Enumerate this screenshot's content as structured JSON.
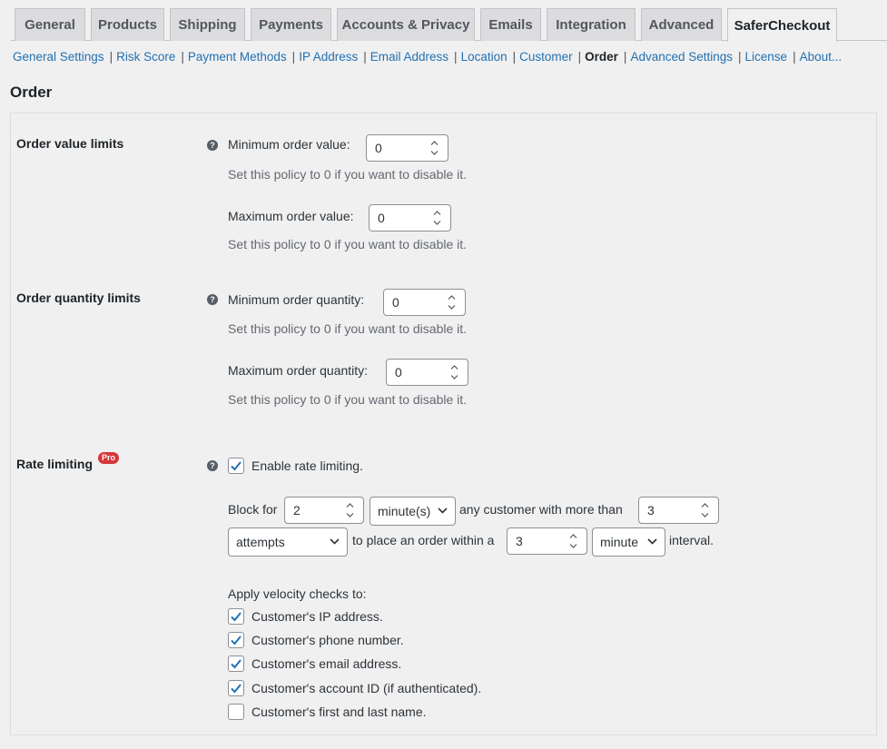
{
  "tabs": [
    {
      "label": "General"
    },
    {
      "label": "Products"
    },
    {
      "label": "Shipping"
    },
    {
      "label": "Payments"
    },
    {
      "label": "Accounts & Privacy"
    },
    {
      "label": "Emails"
    },
    {
      "label": "Integration"
    },
    {
      "label": "Advanced"
    },
    {
      "label": "SaferCheckout",
      "active": true
    }
  ],
  "subnav": [
    {
      "label": "General Settings"
    },
    {
      "label": "Risk Score"
    },
    {
      "label": "Payment Methods"
    },
    {
      "label": "IP Address"
    },
    {
      "label": "Email Address"
    },
    {
      "label": "Location"
    },
    {
      "label": "Customer"
    },
    {
      "label": "Order",
      "current": true
    },
    {
      "label": "Advanced Settings"
    },
    {
      "label": "License"
    },
    {
      "label": "About..."
    }
  ],
  "page_title": "Order",
  "disable_hint": "Set this policy to 0 if you want to disable it.",
  "order_value": {
    "label": "Order value limits",
    "min_label": "Minimum order value:",
    "min_value": "0",
    "max_label": "Maximum order value:",
    "max_value": "0"
  },
  "order_quantity": {
    "label": "Order quantity limits",
    "min_label": "Minimum order quantity:",
    "min_value": "0",
    "max_label": "Maximum order quantity:",
    "max_value": "0"
  },
  "rate_limiting": {
    "label": "Rate limiting",
    "badge": "Pro",
    "enable_label": "Enable rate limiting.",
    "enabled": true,
    "block_for_text": "Block for",
    "block_value": "2",
    "block_unit": "minute(s)",
    "any_customer_text": "any customer with more than",
    "attempts_value": "3",
    "attempts_select": "attempts",
    "place_order_text": "to place an order within a",
    "interval_value": "3",
    "interval_unit": "minute",
    "interval_text": "interval.",
    "velocity_title": "Apply velocity checks to:",
    "checks": [
      {
        "label": "Customer's IP address.",
        "checked": true
      },
      {
        "label": "Customer's phone number.",
        "checked": true
      },
      {
        "label": "Customer's email address.",
        "checked": true
      },
      {
        "label": "Customer's account ID (if authenticated).",
        "checked": true
      },
      {
        "label": "Customer's first and last name.",
        "checked": false
      }
    ]
  },
  "colors": {
    "link": "#2271b1",
    "badge": "#d63638",
    "checkmark": "#2271b1"
  }
}
